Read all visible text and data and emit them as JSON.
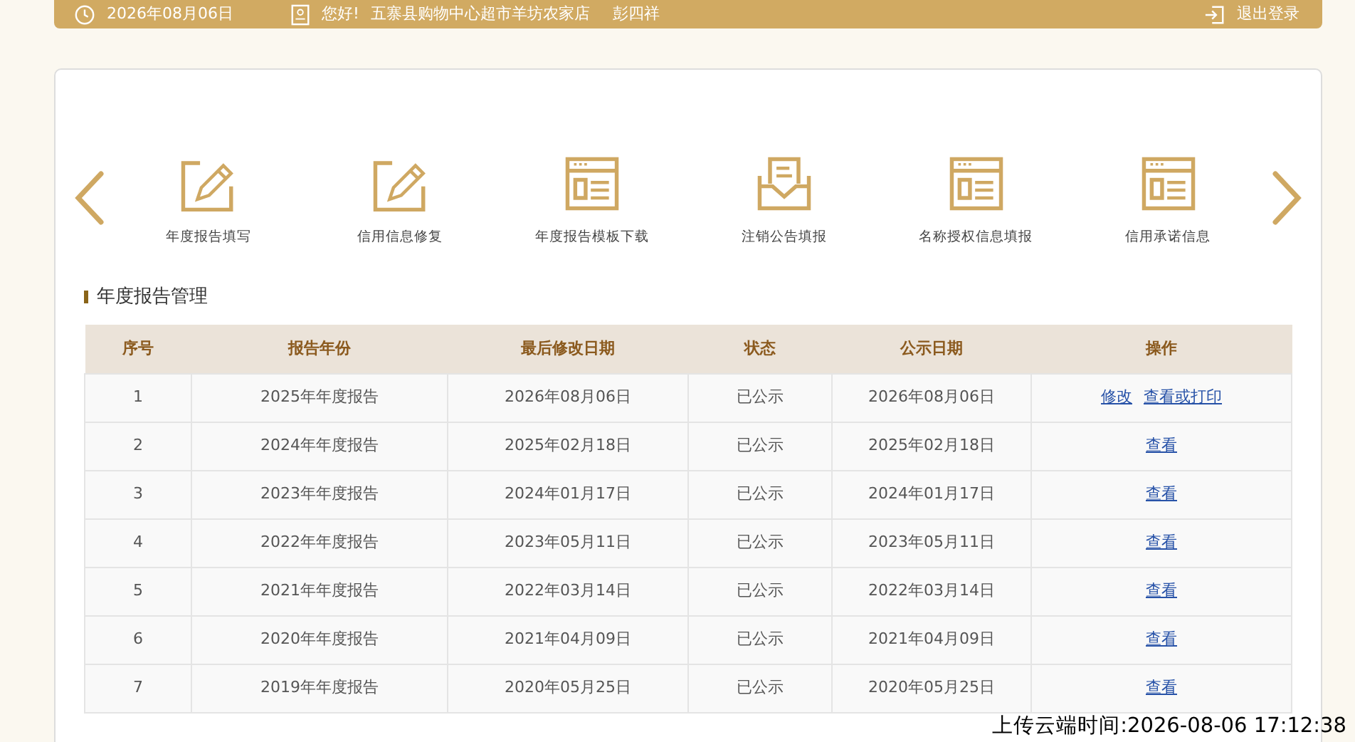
{
  "top_bar": {
    "date": "2026年08月06日",
    "greeting": "您好!",
    "shop": "五寨县购物中心超市羊坊农家店",
    "user": "彭四祥",
    "logout": "退出登录"
  },
  "carousel": {
    "items": [
      {
        "label": "年度报告填写",
        "kind": "edit"
      },
      {
        "label": "信用信息修复",
        "kind": "edit"
      },
      {
        "label": "年度报告模板下载",
        "kind": "window"
      },
      {
        "label": "注销公告填报",
        "kind": "inbox"
      },
      {
        "label": "名称授权信息填报",
        "kind": "window"
      },
      {
        "label": "信用承诺信息",
        "kind": "window"
      }
    ]
  },
  "section_title": "年度报告管理",
  "table": {
    "columns": [
      "序号",
      "报告年份",
      "最后修改日期",
      "状态",
      "公示日期",
      "操作"
    ],
    "rows": [
      {
        "cells": [
          "1",
          "2025年年度报告",
          "2026年08月06日",
          "已公示",
          "2026年08月06日"
        ],
        "actions": [
          "修改",
          "查看或打印"
        ]
      },
      {
        "cells": [
          "2",
          "2024年年度报告",
          "2025年02月18日",
          "已公示",
          "2025年02月18日"
        ],
        "actions": [
          "查看"
        ]
      },
      {
        "cells": [
          "3",
          "2023年年度报告",
          "2024年01月17日",
          "已公示",
          "2024年01月17日"
        ],
        "actions": [
          "查看"
        ]
      },
      {
        "cells": [
          "4",
          "2022年年度报告",
          "2023年05月11日",
          "已公示",
          "2023年05月11日"
        ],
        "actions": [
          "查看"
        ]
      },
      {
        "cells": [
          "5",
          "2021年年度报告",
          "2022年03月14日",
          "已公示",
          "2022年03月14日"
        ],
        "actions": [
          "查看"
        ]
      },
      {
        "cells": [
          "6",
          "2020年年度报告",
          "2021年04月09日",
          "已公示",
          "2021年04月09日"
        ],
        "actions": [
          "查看"
        ]
      },
      {
        "cells": [
          "7",
          "2019年年度报告",
          "2020年05月25日",
          "已公示",
          "2020年05月25日"
        ],
        "actions": [
          "查看"
        ]
      }
    ]
  },
  "upload_stamp": "上传云端时间:2026-08-06 17:12:38"
}
